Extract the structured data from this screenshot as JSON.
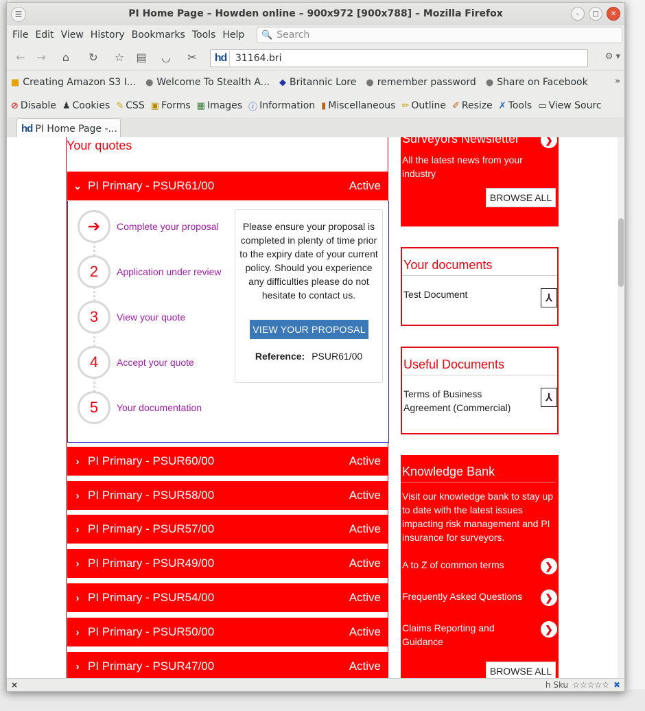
{
  "window": {
    "title": "PI Home Page – Howden online – 900x972 [900x788] – Mozilla Firefox"
  },
  "menu": {
    "items": [
      "File",
      "Edit",
      "View",
      "History",
      "Bookmarks",
      "Tools",
      "Help"
    ],
    "search_placeholder": "Search"
  },
  "nav": {
    "favicon": "hd",
    "url": "31164.bri"
  },
  "bookmarks": [
    {
      "icon": "amazon-s3-icon",
      "label": "Creating Amazon S3 I..."
    },
    {
      "icon": "globe-icon",
      "label": "Welcome To Stealth A..."
    },
    {
      "icon": "dragon-icon",
      "label": "Britannic Lore"
    },
    {
      "icon": "globe-icon",
      "label": "remember password"
    },
    {
      "icon": "globe-icon",
      "label": "Share on Facebook"
    }
  ],
  "devtools": [
    {
      "icon": "disable-icon",
      "label": "Disable"
    },
    {
      "icon": "cookies-icon",
      "label": "Cookies"
    },
    {
      "icon": "css-icon",
      "label": "CSS"
    },
    {
      "icon": "forms-icon",
      "label": "Forms"
    },
    {
      "icon": "images-icon",
      "label": "Images"
    },
    {
      "icon": "information-icon",
      "label": "Information"
    },
    {
      "icon": "miscellaneous-icon",
      "label": "Miscellaneous"
    },
    {
      "icon": "outline-icon",
      "label": "Outline"
    },
    {
      "icon": "resize-icon",
      "label": "Resize"
    },
    {
      "icon": "tools-icon",
      "label": "Tools"
    },
    {
      "icon": "view-source-icon",
      "label": "View Sourc"
    }
  ],
  "tab": {
    "favicon": "hd",
    "label": "PI Home Page -..."
  },
  "quotes": {
    "title": "Your quotes",
    "expanded": {
      "name": "PI Primary - PSUR61/00",
      "status": "Active",
      "steps": [
        {
          "marker": "➔",
          "label": "Complete your proposal"
        },
        {
          "marker": "2",
          "label": "Application under review"
        },
        {
          "marker": "3",
          "label": "View your quote"
        },
        {
          "marker": "4",
          "label": "Accept your quote"
        },
        {
          "marker": "5",
          "label": "Your documentation"
        }
      ],
      "info_text": "Please ensure your proposal is completed in plenty of time prior to the expiry date of your current policy. Should you experience any difficulties please do not hesitate to contact us.",
      "button": "VIEW YOUR PROPOSAL",
      "reference_label": "Reference:",
      "reference_value": "PSUR61/00"
    },
    "collapsed": [
      {
        "name": "PI Primary - PSUR60/00",
        "status": "Active"
      },
      {
        "name": "PI Primary - PSUR58/00",
        "status": "Active"
      },
      {
        "name": "PI Primary - PSUR57/00",
        "status": "Active"
      },
      {
        "name": "PI Primary - PSUR49/00",
        "status": "Active"
      },
      {
        "name": "PI Primary - PSUR54/00",
        "status": "Active"
      },
      {
        "name": "PI Primary - PSUR50/00",
        "status": "Active"
      },
      {
        "name": "PI Primary - PSUR47/00",
        "status": "Active"
      }
    ]
  },
  "newsletter": {
    "title": "Surveyors Newsletter",
    "text": "All the latest news from your industry",
    "button": "BROWSE ALL"
  },
  "documents": {
    "title": "Your documents",
    "item": "Test Document"
  },
  "useful": {
    "title": "Useful Documents",
    "item": "Terms of Business Agreement (Commercial)"
  },
  "knowledge": {
    "title": "Knowledge Bank",
    "text": "Visit our knowledge bank to stay up to date with the latest issues impacting risk management and PI insurance for surveyors.",
    "links": [
      "A to Z of common terms",
      "Frequently Asked Questions",
      "Claims Reporting and Guidance"
    ],
    "button": "BROWSE ALL"
  },
  "statusbar": {
    "close": "×",
    "right": "h Sku"
  },
  "colors": {
    "brand_red": "#ff0000",
    "step_purple": "#a020a8",
    "button_blue": "#3a78b8"
  }
}
